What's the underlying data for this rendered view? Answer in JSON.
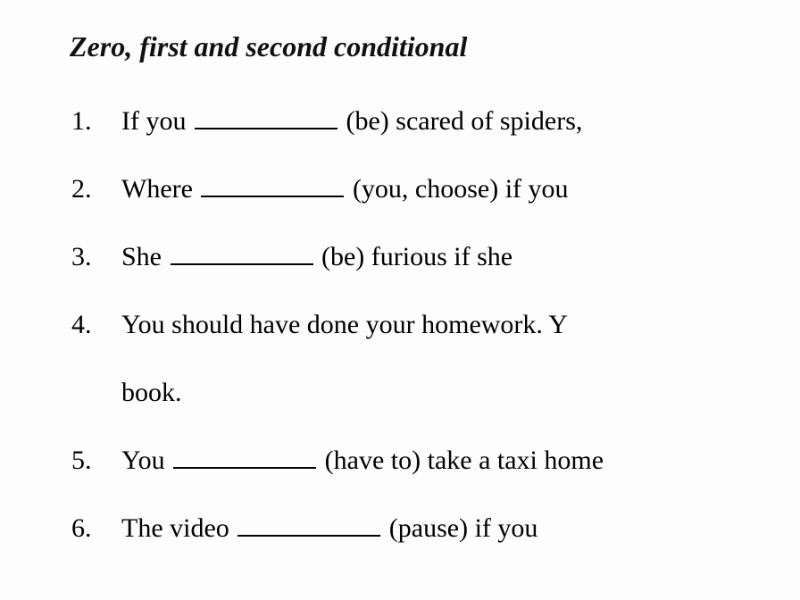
{
  "title": "Zero, first and second conditional",
  "items": [
    {
      "num": "1.",
      "pre": "If you ",
      "hint": " (be) scared of spiders, ",
      "trail": ""
    },
    {
      "num": "2.",
      "pre": "Where ",
      "hint": " (you, choose) if you ",
      "trail": ""
    },
    {
      "num": "3.",
      "pre": "She ",
      "hint": " (be) furious if she ",
      "trail": ""
    },
    {
      "num": "4.",
      "line1": "You should have done your homework. Y",
      "line2": "book."
    },
    {
      "num": "5.",
      "pre": "You ",
      "hint": " (have to) take a taxi home ",
      "trail": ""
    },
    {
      "num": "6.",
      "pre": "The video ",
      "hint": " (pause) if you ",
      "trail": ""
    }
  ]
}
